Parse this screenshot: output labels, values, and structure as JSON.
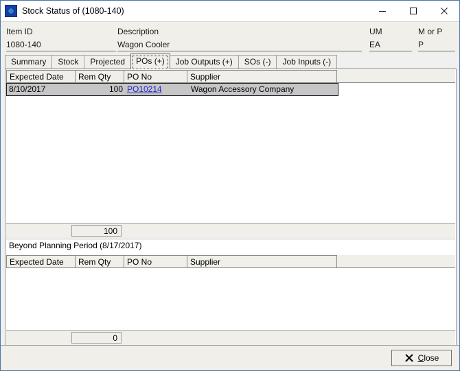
{
  "window": {
    "title": "Stock Status of (1080-140)",
    "icon": "app-window-icon",
    "controls": {
      "minimize": "minimize-icon",
      "maximize": "maximize-icon",
      "close": "close-icon"
    }
  },
  "header_fields": [
    {
      "label": "Item ID",
      "value": "1080-140"
    },
    {
      "label": "Description",
      "value": "Wagon Cooler"
    },
    {
      "label": "UM",
      "value": "EA"
    },
    {
      "label": "M or P",
      "value": "P"
    }
  ],
  "tabs": [
    {
      "label": "Summary",
      "active": false
    },
    {
      "label": "Stock",
      "active": false
    },
    {
      "label": "Projected",
      "active": false
    },
    {
      "label": "POs (+)",
      "active": true
    },
    {
      "label": "Job Outputs (+)",
      "active": false
    },
    {
      "label": "SOs (-)",
      "active": false
    },
    {
      "label": "Job Inputs (-)",
      "active": false
    }
  ],
  "planning_grid": {
    "columns": [
      "Expected Date",
      "Rem Qty",
      "PO No",
      "Supplier"
    ],
    "rows": [
      {
        "expected_date": "8/10/2017",
        "rem_qty": "100",
        "po_no": "PO10214",
        "supplier": "Wagon Accessory Company",
        "selected": true
      }
    ],
    "total": "100"
  },
  "beyond_section": {
    "label": "Beyond Planning Period (8/17/2017)",
    "columns": [
      "Expected Date",
      "Rem Qty",
      "PO No",
      "Supplier"
    ],
    "rows": [],
    "total": "0"
  },
  "footer": {
    "close_label": "Close",
    "close_accel": "C"
  },
  "colors": {
    "window_border": "#4a76a8",
    "face": "#f0efe9",
    "selection": "#c6c6c6",
    "link": "#2222cc"
  }
}
